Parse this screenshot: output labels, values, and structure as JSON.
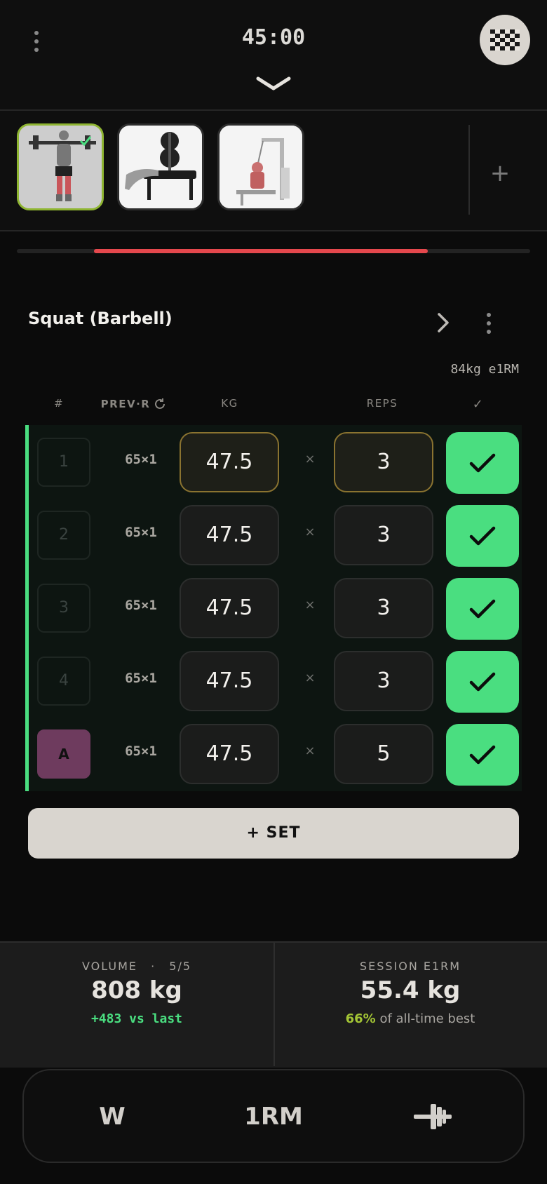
{
  "header": {
    "timer": "45:00"
  },
  "exercise": {
    "title": "Squat (Barbell)",
    "e1rm": "84kg e1RM"
  },
  "progress": {
    "fraction": 0.65
  },
  "table": {
    "headers": {
      "num": "#",
      "prev": "PREV·R",
      "kg": "KG",
      "reps": "REPS",
      "check": "✓"
    },
    "times": "×",
    "rows": [
      {
        "set": "1",
        "prev": "65×1",
        "kg": "47.5",
        "reps": "3",
        "done": true
      },
      {
        "set": "2",
        "prev": "65×1",
        "kg": "47.5",
        "reps": "3",
        "done": true
      },
      {
        "set": "3",
        "prev": "65×1",
        "kg": "47.5",
        "reps": "3",
        "done": true
      },
      {
        "set": "4",
        "prev": "65×1",
        "kg": "47.5",
        "reps": "3",
        "done": true
      },
      {
        "set": "A",
        "prev": "65×1",
        "kg": "47.5",
        "reps": "5",
        "done": true
      }
    ]
  },
  "add_set_label": "+ SET",
  "stats": {
    "volume": {
      "label": "VOLUME",
      "dot": "·",
      "count": "5/5",
      "value": "808 kg",
      "delta": "+483 vs last"
    },
    "session": {
      "label": "SESSION E1RM",
      "value": "55.4 kg",
      "pct": "66%",
      "rest": " of all-time best"
    }
  },
  "nav": {
    "w": "W",
    "rm": "1RM"
  },
  "colors": {
    "accent_green": "#4ade80",
    "progress_red": "#e5484d",
    "active_thumb": "#8fb532",
    "warmup_badge": "#6e3b5e"
  }
}
